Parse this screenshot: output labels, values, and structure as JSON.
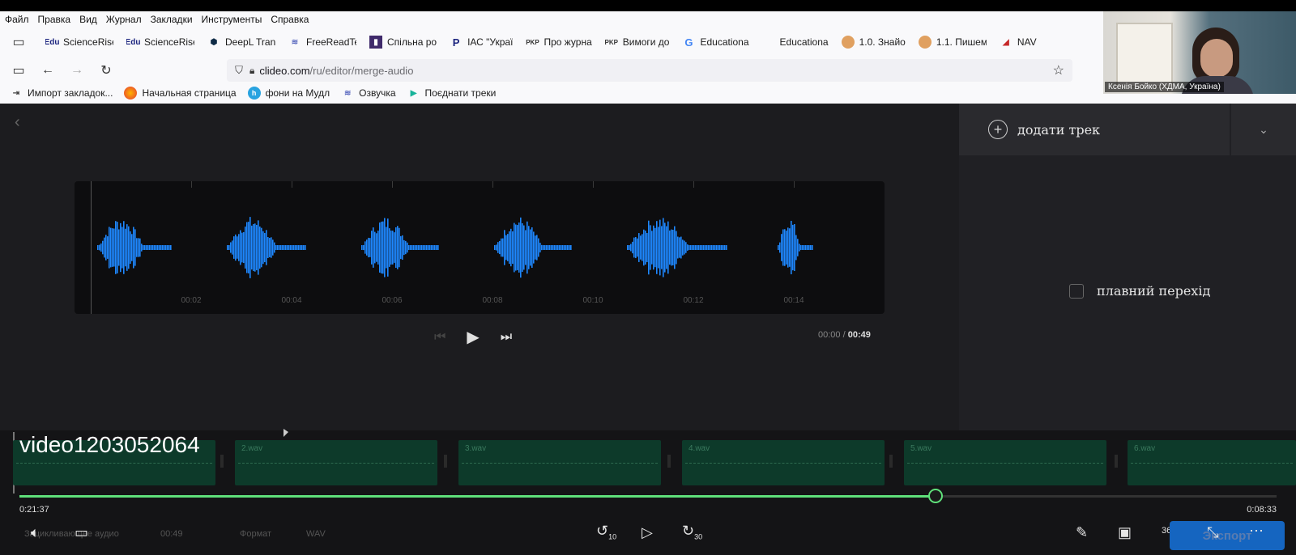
{
  "menubar": [
    "Файл",
    "Правка",
    "Вид",
    "Журнал",
    "Закладки",
    "Инструменты",
    "Справка"
  ],
  "bookmarks_top": [
    {
      "icon": "edu-icon",
      "label": "ScienceRise"
    },
    {
      "icon": "edu-icon",
      "label": "ScienceRise"
    },
    {
      "icon": "deepl-icon",
      "label": "DeepL Tran"
    },
    {
      "icon": "freeread-icon",
      "label": "FreeReadTe"
    },
    {
      "icon": "spilna-icon",
      "label": "Спільна ро"
    },
    {
      "icon": "p-icon",
      "label": "ІАС \"Украї"
    },
    {
      "icon": "pkp-icon",
      "label": "Про журна"
    },
    {
      "icon": "pkp-icon",
      "label": "Вимоги до"
    },
    {
      "icon": "google-icon",
      "label": "Educationa"
    },
    {
      "icon": "blank-icon",
      "label": "Educationa"
    },
    {
      "icon": "avatar-icon",
      "label": "1.0. Знайо"
    },
    {
      "icon": "avatar-icon",
      "label": "1.1. Пишем"
    },
    {
      "icon": "nav-icon",
      "label": "NAV"
    }
  ],
  "url": {
    "host": "clideo.com",
    "path": "/ru/editor/merge-audio"
  },
  "bookmarks_bottom": [
    {
      "icon": "import-icon",
      "label": "Импорт закладок..."
    },
    {
      "icon": "firefox-icon",
      "label": "Начальная страница"
    },
    {
      "icon": "moodle-icon",
      "label": "фони на Мудл"
    },
    {
      "icon": "freeread-icon",
      "label": "Озвучка"
    },
    {
      "icon": "play-icon",
      "label": "Поєднати треки"
    }
  ],
  "webcam": {
    "name": "Ксенія Бойко (ХДМА, Україна)"
  },
  "panel": {
    "add_track": "додати трек",
    "crossfade": "плавний перехід"
  },
  "waveform": {
    "ticks": [
      "00:02",
      "00:04",
      "00:06",
      "00:08",
      "00:10",
      "00:12",
      "00:14"
    ]
  },
  "player": {
    "current": "00:00",
    "separator": "/",
    "total": "00:49"
  },
  "timeline": {
    "video_title": "video1203052064",
    "clips": [
      "",
      "2.wav",
      "3.wav",
      "4.wav",
      "5.wav",
      "6.wav"
    ],
    "time_left": "0:21:37",
    "time_right": "0:08:33",
    "progress_fraction": 0.729
  },
  "bottombar": {
    "audio_label": "Зацикливающее аудио",
    "audio_value": "00:49",
    "format_label": "Формат",
    "format_value": "WAV",
    "rewind_label": "10",
    "forward_label": "30",
    "vr_label": "360",
    "export_label": "Экспорт"
  },
  "colors": {
    "accent_green": "#5fe07a",
    "wave_blue": "#1e88ff",
    "export_blue": "#1565c0"
  }
}
